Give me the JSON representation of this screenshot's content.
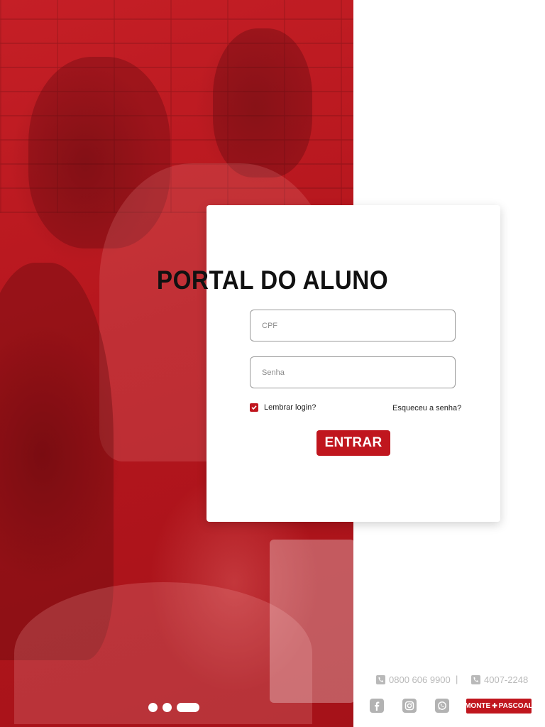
{
  "portal": {
    "title": "PORTAL DO ALUNO",
    "cpf_placeholder": "CPF",
    "senha_placeholder": "Senha",
    "remember_label": "Lembrar login?",
    "remember_checked": true,
    "forgot_label": "Esqueceu a senha?",
    "submit_label": "ENTRAR"
  },
  "carousel": {
    "slides": 3,
    "active_index": 2
  },
  "contacts": {
    "phone1": "0800 606 9900",
    "separator": "|",
    "phone2": "4007-2248",
    "icons": [
      "facebook-icon",
      "instagram-icon",
      "whatsapp-icon"
    ]
  },
  "logo": {
    "left": "MONTE",
    "right": "PASCOAL"
  },
  "colors": {
    "brand_red": "#c0161e",
    "footer_gray": "#b3b3b3"
  }
}
